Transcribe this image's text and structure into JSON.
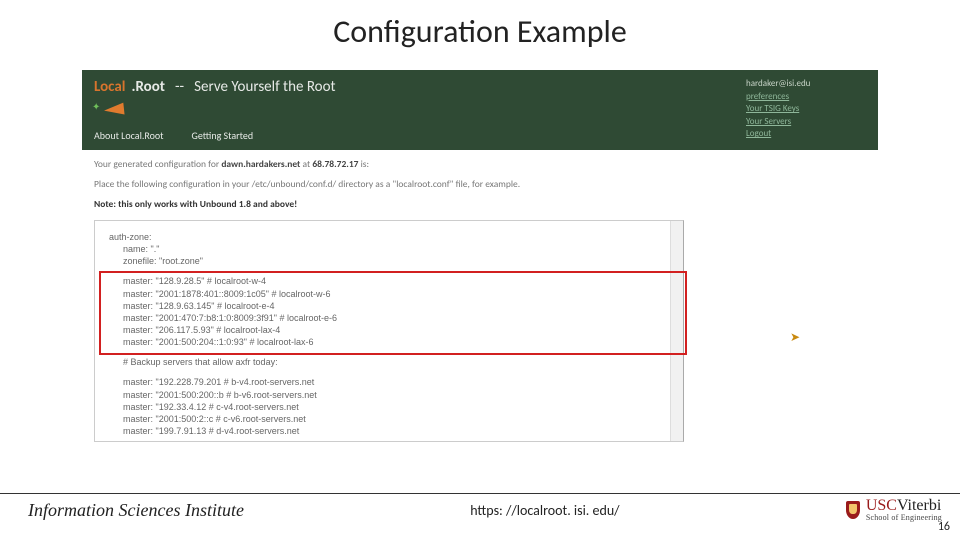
{
  "title": "Configuration Example",
  "header": {
    "brand_local": "Local",
    "brand_root": ".Root",
    "brand_dash": "--",
    "brand_tag": "Serve Yourself the Root",
    "nav_about": "About Local.Root",
    "nav_start": "Getting Started"
  },
  "account": {
    "email": "hardaker@isi.edu",
    "preferences": "preferences",
    "tsig": "Your TSIG Keys",
    "servers": "Your Servers",
    "logout": "Logout"
  },
  "body": {
    "gen_prefix": "Your generated configuration for ",
    "gen_host": "dawn.hardakers.net",
    "gen_mid": " at ",
    "gen_ip": "68.78.72.17",
    "gen_suffix": " is:",
    "place": "Place the following configuration in your /etc/unbound/conf.d/ directory as a \"localroot.conf\" file, for example.",
    "note": "Note: this only works with Unbound 1.8 and above!"
  },
  "config": {
    "authzone": "auth-zone:",
    "name": "name: \".\"",
    "zonefile": "zonefile: \"root.zone\"",
    "masters": [
      "master: \"128.9.28.5\" # localroot-w-4",
      "master: \"2001:1878:401::8009:1c05\" # localroot-w-6",
      "master: \"128.9.63.145\" # localroot-e-4",
      "master: \"2001:470:7:b8:1:0:8009:3f91\" # localroot-e-6",
      "master: \"206.117.5.93\" # localroot-lax-4",
      "master: \"2001:500:204::1:0:93\" # localroot-lax-6"
    ],
    "backup_comment": "# Backup servers that allow axfr today:",
    "backups": [
      "master: \"192.228.79.201 # b-v4.root-servers.net",
      "master: \"2001:500:200::b # b-v6.root-servers.net",
      "master: \"192.33.4.12 # c-v4.root-servers.net",
      "master: \"2001:500:2::c # c-v6.root-servers.net",
      "master: \"199.7.91.13 # d-v4.root-servers.net"
    ]
  },
  "footer": {
    "isi": "Information Sciences Institute",
    "url": "https: //localroot. isi. edu/",
    "usc": "USC",
    "viterbi": "Viterbi",
    "school": "School of Engineering",
    "page": "16"
  }
}
